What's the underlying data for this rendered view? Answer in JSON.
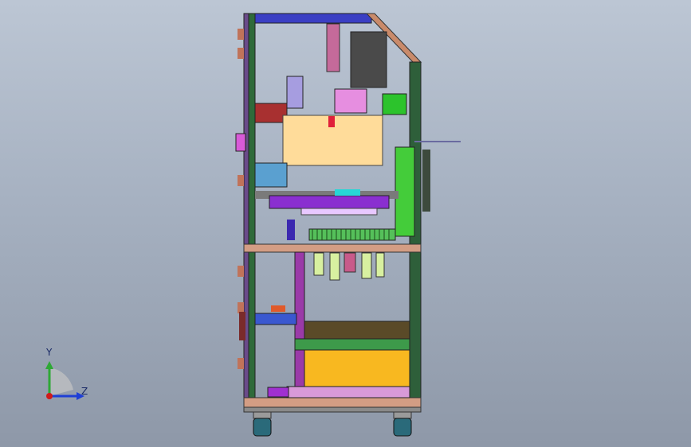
{
  "view": {
    "orientation_axes": {
      "y_label": "Y",
      "z_label": "Z",
      "y_color": "#2ea836",
      "z_color": "#1e3fd6",
      "x_color": "#d11a1a"
    },
    "background_top": "#bcc6d4",
    "background_bottom": "#8e98a8"
  }
}
